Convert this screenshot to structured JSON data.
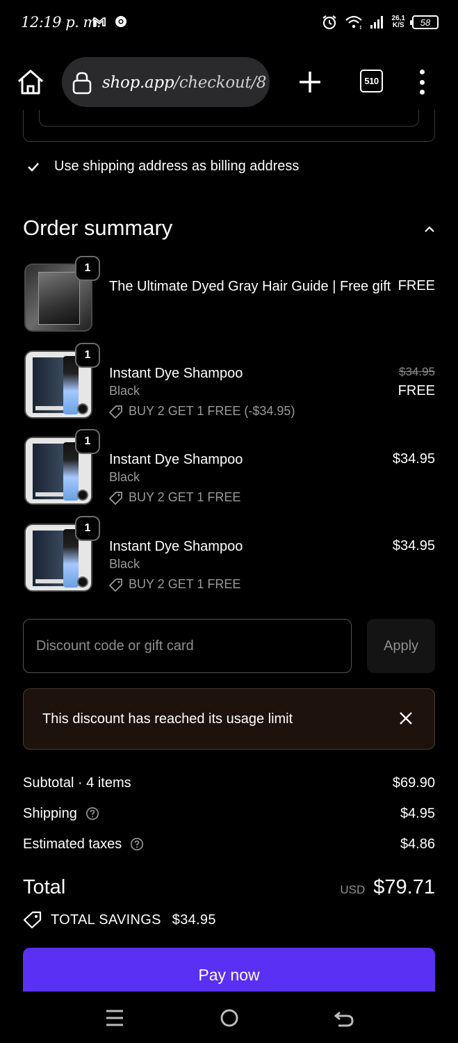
{
  "status_bar": {
    "time": "12:19 p. m.",
    "net_speed_value": "26,1",
    "net_speed_unit": "K/S",
    "battery": "58",
    "icons": [
      "gmail-icon",
      "chrome-icon",
      "alarm-icon",
      "wifi-icon",
      "signal-icon",
      "battery-icon"
    ]
  },
  "browser": {
    "url_host": "shop.app",
    "url_path": "/checkout/8",
    "tab_count": "510"
  },
  "billing": {
    "label": "Use shipping address as billing address",
    "checked": true
  },
  "order_summary": {
    "title": "Order summary",
    "items": [
      {
        "qty": "1",
        "name": "The Ultimate Dyed Gray Hair Guide | Free gift",
        "variant": "",
        "discount": "",
        "price": "FREE",
        "original_price": ""
      },
      {
        "qty": "1",
        "name": "Instant Dye Shampoo",
        "variant": "Black",
        "discount": "BUY 2 GET 1 FREE (-$34.95)",
        "price": "FREE",
        "original_price": "$34.95"
      },
      {
        "qty": "1",
        "name": "Instant Dye Shampoo",
        "variant": "Black",
        "discount": "BUY 2 GET 1 FREE",
        "price": "$34.95",
        "original_price": ""
      },
      {
        "qty": "1",
        "name": "Instant Dye Shampoo",
        "variant": "Black",
        "discount": "BUY 2 GET 1 FREE",
        "price": "$34.95",
        "original_price": ""
      }
    ]
  },
  "discount": {
    "placeholder": "Discount code or gift card",
    "value": "",
    "apply_label": "Apply",
    "error": "This discount has reached its usage limit"
  },
  "totals": {
    "subtotal_label": "Subtotal · 4 items",
    "subtotal": "$69.90",
    "shipping_label": "Shipping",
    "shipping": "$4.95",
    "taxes_label": "Estimated taxes",
    "taxes": "$4.86",
    "total_label": "Total",
    "currency": "USD",
    "total": "$79.71",
    "savings_label": "TOTAL SAVINGS",
    "savings": "$34.95"
  },
  "pay": {
    "label": "Pay now"
  },
  "colors": {
    "accent": "#5a31f4",
    "alert_bg": "#1d120c"
  }
}
